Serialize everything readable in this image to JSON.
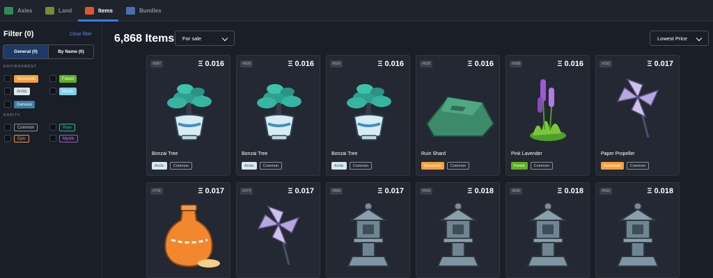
{
  "nav": {
    "tabs": [
      {
        "label": "Axies",
        "icon": "axie-icon"
      },
      {
        "label": "Land",
        "icon": "land-icon"
      },
      {
        "label": "Items",
        "icon": "item-pot-icon",
        "active": true
      },
      {
        "label": "Bundles",
        "icon": "bundle-icon"
      }
    ]
  },
  "sidebar": {
    "filter_title": "Filter (0)",
    "clear_label": "Clear filter",
    "segments": [
      "General (0)",
      "By Name (0)"
    ],
    "environment_label": "ENVIRONMENT",
    "environment": [
      "Savannah",
      "Forest",
      "Arctic",
      "Mystic",
      "Genesis"
    ],
    "rarity_label": "RARITY",
    "rarity": [
      "Common",
      "Rare",
      "Epic",
      "Mystic"
    ]
  },
  "main": {
    "count_title": "6,868 Items",
    "sale_filter": "For sale",
    "sort": "Lowest Price"
  },
  "cards": [
    {
      "id": "#387",
      "price": "Ξ 0.016",
      "name": "Bonzai Tree",
      "env": "Arctic",
      "rarity": "Common",
      "art": "bonsai"
    },
    {
      "id": "#928",
      "price": "Ξ 0.016",
      "name": "Bonzai Tree",
      "env": "Arctic",
      "rarity": "Common",
      "art": "bonsai"
    },
    {
      "id": "#529",
      "price": "Ξ 0.016",
      "name": "Bonzai Tree",
      "env": "Arctic",
      "rarity": "Common",
      "art": "bonsai"
    },
    {
      "id": "#625",
      "price": "Ξ 0.016",
      "name": "Ruin Shard",
      "env": "Savannah",
      "rarity": "Common",
      "art": "shard"
    },
    {
      "id": "#268",
      "price": "Ξ 0.016",
      "name": "Pink Lavender",
      "env": "Forest",
      "rarity": "Common",
      "art": "lavender"
    },
    {
      "id": "#292",
      "price": "Ξ 0.017",
      "name": "Paper Propeller",
      "env": "Savannah",
      "rarity": "Common",
      "art": "pinwheel"
    },
    {
      "id": "#731",
      "price": "Ξ 0.017",
      "art": "vase"
    },
    {
      "id": "#373",
      "price": "Ξ 0.017",
      "art": "pinwheel"
    },
    {
      "id": "#896",
      "price": "Ξ 0.017",
      "art": "lantern"
    },
    {
      "id": "#569",
      "price": "Ξ 0.018",
      "art": "lantern"
    },
    {
      "id": "#630",
      "price": "Ξ 0.018",
      "art": "lantern"
    },
    {
      "id": "#593",
      "price": "Ξ 0.018",
      "art": "lantern"
    }
  ],
  "colors": {
    "accent": "#2f80ed",
    "savannah": "#f7a13d",
    "forest": "#5eb31e",
    "arctic": "#d9e9ef",
    "mystic": "#7fd0e8",
    "genesis": "#3d7fa0",
    "rare": "#2fb7a0",
    "epic": "#f2994a",
    "mystic_rarity": "#9b59d6"
  }
}
